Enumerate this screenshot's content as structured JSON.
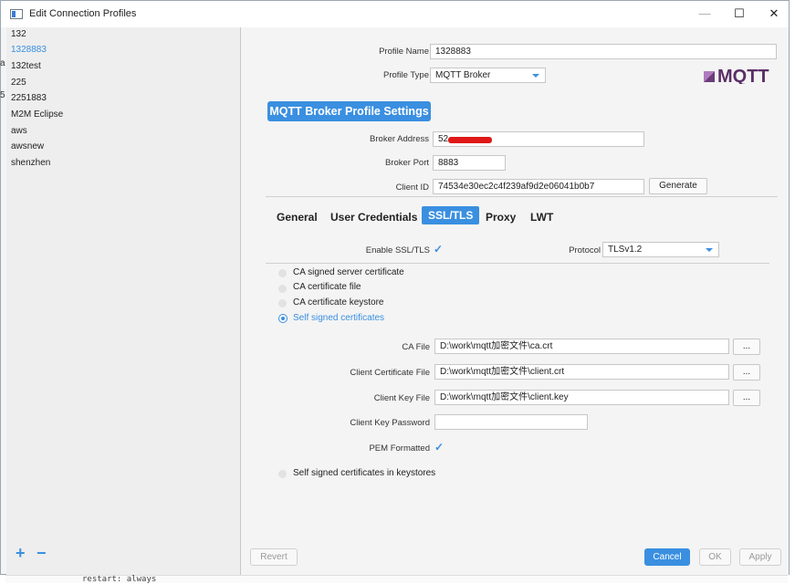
{
  "window": {
    "title": "Edit Connection Profiles",
    "min": "—",
    "max": "☐",
    "close": "✕"
  },
  "sidebar": {
    "items": [
      {
        "label": "132"
      },
      {
        "label": "1328883",
        "selected": true
      },
      {
        "label": "132test"
      },
      {
        "label": "225"
      },
      {
        "label": "2251883"
      },
      {
        "label": "M2M Eclipse"
      },
      {
        "label": "aws"
      },
      {
        "label": "awsnew"
      },
      {
        "label": "shenzhen"
      }
    ],
    "add_label": "+",
    "remove_label": "−"
  },
  "profile": {
    "name_label": "Profile Name",
    "name_value": "1328883",
    "type_label": "Profile Type",
    "type_value": "MQTT Broker",
    "logo_text": "MQTT"
  },
  "broker": {
    "section_title": "MQTT Broker Profile Settings",
    "address_label": "Broker Address",
    "address_value": "52",
    "port_label": "Broker Port",
    "port_value": "8883",
    "client_id_label": "Client ID",
    "client_id_value": "74534e30ec2c4f239af9d2e06041b0b7",
    "generate_label": "Generate"
  },
  "tabs": [
    "General",
    "User Credentials",
    "SSL/TLS",
    "Proxy",
    "LWT"
  ],
  "active_tab": "SSL/TLS",
  "ssl": {
    "enable_label": "Enable SSL/TLS",
    "enable_checked": true,
    "protocol_label": "Protocol",
    "protocol_value": "TLSv1.2",
    "options": [
      {
        "label": "CA signed server certificate",
        "selected": false
      },
      {
        "label": "CA certificate file",
        "selected": false
      },
      {
        "label": "CA certificate keystore",
        "selected": false
      },
      {
        "label": "Self signed certificates",
        "selected": true
      }
    ],
    "ca_file_label": "CA File",
    "ca_file_value": "D:\\work\\mqtt加密文件\\ca.crt",
    "client_cert_label": "Client Certificate File",
    "client_cert_value": "D:\\work\\mqtt加密文件\\client.crt",
    "client_key_label": "Client Key File",
    "client_key_value": "D:\\work\\mqtt加密文件\\client.key",
    "browse_label": "...",
    "key_password_label": "Client Key Password",
    "key_password_value": "",
    "pem_label": "PEM Formatted",
    "pem_checked": true,
    "keystore_option": "Self signed certificates in keystores"
  },
  "footer": {
    "revert": "Revert",
    "cancel": "Cancel",
    "ok": "OK",
    "apply": "Apply"
  },
  "background_fragments": {
    "left_a": "a",
    "left_5": "5",
    "bottom_code": "restart: always"
  },
  "colors": {
    "accent": "#3a8fe0",
    "redaction": "#e01818"
  }
}
